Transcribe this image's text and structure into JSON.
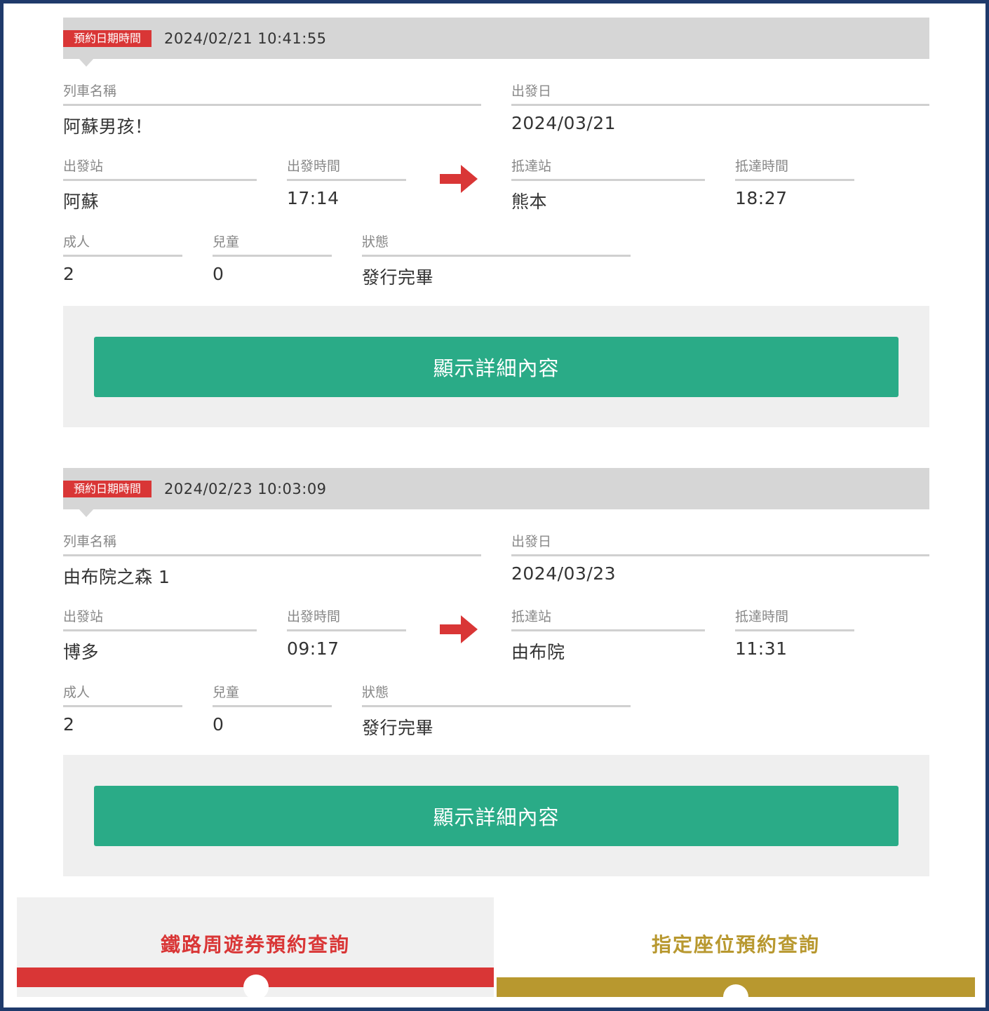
{
  "reservations": [
    {
      "badge_label": "預約日期時間",
      "booked_at": "2024/02/21 10:41:55",
      "train_name_label": "列車名稱",
      "train_name": "阿蘇男孩！",
      "departure_date_label": "出發日",
      "departure_date": "2024/03/21",
      "departure_station_label": "出發站",
      "departure_station": "阿蘇",
      "departure_time_label": "出發時間",
      "departure_time": "17:14",
      "arrival_station_label": "抵達站",
      "arrival_station": "熊本",
      "arrival_time_label": "抵達時間",
      "arrival_time": "18:27",
      "adult_label": "成人",
      "adults": "2",
      "child_label": "兒童",
      "children": "0",
      "status_label": "狀態",
      "status": "發行完畢",
      "detail_button": "顯示詳細內容"
    },
    {
      "badge_label": "預約日期時間",
      "booked_at": "2024/02/23 10:03:09",
      "train_name_label": "列車名稱",
      "train_name": "由布院之森 1",
      "departure_date_label": "出發日",
      "departure_date": "2024/03/23",
      "departure_station_label": "出發站",
      "departure_station": "博多",
      "departure_time_label": "出發時間",
      "departure_time": "09:17",
      "arrival_station_label": "抵達站",
      "arrival_station": "由布院",
      "arrival_time_label": "抵達時間",
      "arrival_time": "11:31",
      "adult_label": "成人",
      "adults": "2",
      "child_label": "兒童",
      "children": "0",
      "status_label": "狀態",
      "status": "發行完畢",
      "detail_button": "顯示詳細內容"
    }
  ],
  "bottom_nav": {
    "rail_pass_tab": "鐵路周遊券預約查詢",
    "reserved_seat_tab": "指定座位預約查詢"
  },
  "colors": {
    "badge": "#d93636",
    "arrow": "#d93636",
    "detail_button": "#2aab87",
    "rail_pass_accent": "#d93636",
    "reserved_seat_accent": "#b8982f",
    "header_bg": "#d6d6d6",
    "panel_bg": "#efefef",
    "frame": "#1f3a6b"
  },
  "icons": {
    "direction_arrow": "arrow-right-icon"
  }
}
